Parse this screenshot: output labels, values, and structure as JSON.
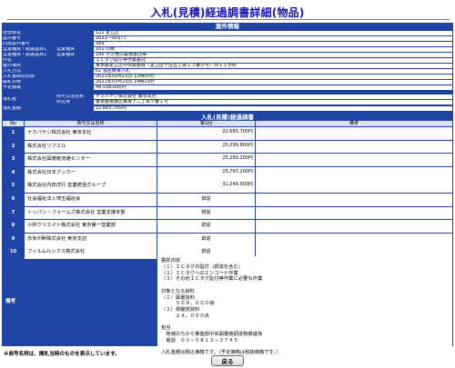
{
  "page": {
    "title": "入札(見積)経過調書詳細(物品)"
  },
  "case_info": {
    "heading": "案件情報",
    "rows": [
      {
        "label": "自治体名",
        "value": "121 足立区"
      },
      {
        "label": "案件番号",
        "value": "2021―00377"
      },
      {
        "label": "内部案件番号",
        "value": "389"
      },
      {
        "label": "営業種目・取扱品目1",
        "sublabel": "営業種目",
        "value": "101 印刷"
      },
      {
        "label": "営業種目・取扱品目2",
        "sublabel": "営業種目",
        "value": "190 その他の業務委託等"
      },
      {
        "label": "件名",
        "value": "ＩＣタグ貼付等作業委託"
      },
      {
        "label": "履行場所",
        "value": "東京都足立区中央図書館（足立区千住五丁目１３番５号）外１１か所"
      },
      {
        "label": "入札方式",
        "value": "02 指名競争入札"
      },
      {
        "label": "入札書締切日時",
        "value": "2021年03月23日 12時00分"
      },
      {
        "label": "開札日時",
        "value": "2021年03月23日 14時10分"
      },
      {
        "label": "予定価格",
        "value": "49,538,000円"
      }
    ],
    "winner": {
      "label": "落札者",
      "name_label": "商号又は名称",
      "name_value": "ナカバヤシ株式会社 東京本社",
      "address_label": "所在地",
      "address_value": "東京都板橋区東坂下二丁目５番１号"
    },
    "contract": {
      "label": "落札金額",
      "value": "22,665,700円"
    }
  },
  "bid_table": {
    "heading": "入札(見積)経過調書",
    "headers": {
      "no": "No",
      "name": "商号又は名称",
      "round1": "第1回",
      "remarks": "備考"
    },
    "rows": [
      {
        "no": "1",
        "name": "ナカバヤシ株式会社 東京本社",
        "amount": "22,665,700円",
        "status": ""
      },
      {
        "no": "2",
        "name": "株式会社ソフエル",
        "amount": "25,099,800円",
        "status": ""
      },
      {
        "no": "3",
        "name": "株式会社図書館流通センター",
        "amount": "25,269,200円",
        "status": ""
      },
      {
        "no": "4",
        "name": "株式会社日本ブッカー",
        "amount": "25,797,200円",
        "status": ""
      },
      {
        "no": "5",
        "name": "株式会社内田洋行 営業統括グループ",
        "amount": "31,249,900円",
        "status": ""
      },
      {
        "no": "6",
        "name": "社会福祉法人埼玉福祉会",
        "amount": "",
        "status": "辞退"
      },
      {
        "no": "7",
        "name": "トッパン・フォームズ株式会社 営業支援本部",
        "amount": "",
        "status": "辞退"
      },
      {
        "no": "8",
        "name": "小林クリエイト株式会社 東京第一営業部",
        "amount": "",
        "status": "辞退"
      },
      {
        "no": "9",
        "name": "赤坂印刷株式会社 東京支店",
        "amount": "",
        "status": "辞退"
      },
      {
        "no": "10",
        "name": "フィルムルックス株式会社",
        "amount": "",
        "status": "辞退"
      }
    ],
    "remarks": {
      "label": "備考",
      "lines": [
        "委託内容",
        "（１）ＩＣタグの貼付（調達を含む）",
        "（２）ＩＣタグへのエンコード作業",
        "（３）その他ＩＣタグ貼付等作業に必要な作業",
        "",
        "対象となる資料",
        "（１）図書資料",
        "　　　５０９，０００冊",
        "（２）視聴覚資料",
        "　　　２４，０００点",
        "",
        "担当",
        "　地域のちから推進部中央図書館調達物推進係",
        "　電話　０３－５８１３－３７４５",
        "",
        "入札金額は税込価格です。（予定価格は税抜価格です。）"
      ]
    }
  },
  "footnote": "※商号名称は、開札当時のものを表示しています。",
  "buttons": {
    "back": "戻る"
  }
}
